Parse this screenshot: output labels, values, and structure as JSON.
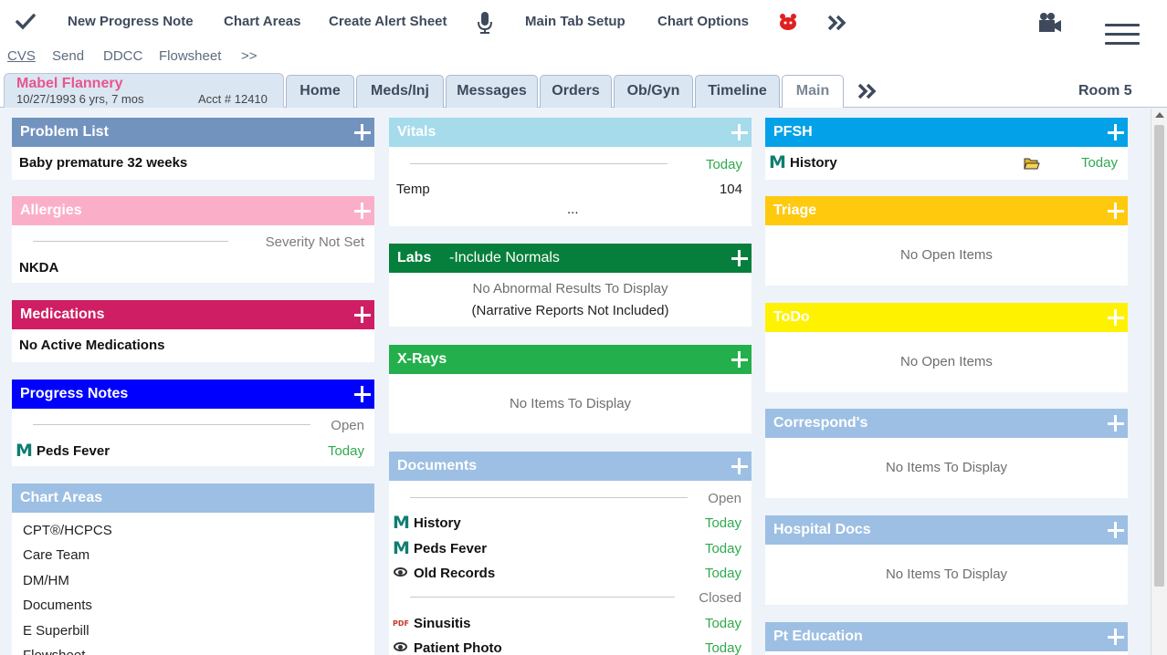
{
  "toolbar": {
    "new_progress_note": "New Progress Note",
    "chart_areas": "Chart Areas",
    "create_alert_sheet": "Create Alert Sheet",
    "main_tab_setup": "Main Tab Setup",
    "chart_options": "Chart Options"
  },
  "subbar": {
    "cvs": "CVS",
    "send": "Send",
    "ddcc": "DDCC",
    "flowsheet": "Flowsheet",
    "more": ">>"
  },
  "patient": {
    "name": "Mabel Flannery",
    "dob_age": "10/27/1993   6 yrs, 7 mos",
    "acct": "Acct # 12410"
  },
  "tabs": [
    "Home",
    "Meds/Inj",
    "Messages",
    "Orders",
    "Ob/Gyn",
    "Timeline",
    "Main"
  ],
  "room": "Room 5",
  "panels": {
    "problem_list": {
      "title": "Problem List",
      "item": "Baby premature 32 weeks",
      "color": "#7393bf"
    },
    "allergies": {
      "title": "Allergies",
      "severity": "Severity Not Set",
      "item": "NKDA",
      "color": "#fbaec8"
    },
    "medications": {
      "title": "Medications",
      "item": "No Active Medications",
      "color": "#cf1e63"
    },
    "progress_notes": {
      "title": "Progress Notes",
      "status": "Open",
      "item": "Peds Fever",
      "date": "Today",
      "color": "#0000ff"
    },
    "chart_areas": {
      "title": "Chart Areas",
      "items": [
        "CPT®/HCPCS",
        "Care Team",
        "DM/HM",
        "Documents",
        "E Superbill",
        "Flowsheet"
      ],
      "color": "#9dbfe3"
    },
    "vitals": {
      "title": "Vitals",
      "date": "Today",
      "temp_label": "Temp",
      "temp_value": "104",
      "ellipsis": "...",
      "color": "#a5dbeb"
    },
    "labs": {
      "title": "Labs",
      "include": "-Include Normals",
      "msg1": "No Abnormal Results To Display",
      "msg2": "(Narrative Reports Not Included)",
      "color": "#067f3c"
    },
    "xrays": {
      "title": "X-Rays",
      "msg": "No Items To Display",
      "color": "#23b04c"
    },
    "documents": {
      "title": "Documents",
      "open_label": "Open",
      "closed_label": "Closed",
      "open_items": [
        {
          "icon": "m-icon",
          "name": "History",
          "date": "Today"
        },
        {
          "icon": "m-icon",
          "name": "Peds Fever",
          "date": "Today"
        },
        {
          "icon": "eye-icon",
          "name": "Old Records",
          "date": "Today"
        }
      ],
      "closed_items": [
        {
          "icon": "pdf-icon",
          "name": "Sinusitis",
          "date": "Today"
        },
        {
          "icon": "eye-icon",
          "name": "Patient Photo",
          "date": "Today"
        }
      ],
      "pdf_text": "PDF",
      "color": "#9dbfe3"
    },
    "pfsh": {
      "title": "PFSH",
      "item": "History",
      "date": "Today",
      "color": "#03a2e8"
    },
    "triage": {
      "title": "Triage",
      "msg": "No Open Items",
      "color": "#ffc90e"
    },
    "todo": {
      "title": "ToDo",
      "msg": "No Open Items",
      "color": "#fff200"
    },
    "corresponds": {
      "title": "Correspond's",
      "msg": "No Items To Display",
      "color": "#9dbfe3"
    },
    "hospital_docs": {
      "title": "Hospital Docs",
      "msg": "No Items To Display",
      "color": "#9dbfe3"
    },
    "pt_education": {
      "title": "Pt Education",
      "color": "#9dbfe3"
    }
  },
  "m_letter": "M"
}
